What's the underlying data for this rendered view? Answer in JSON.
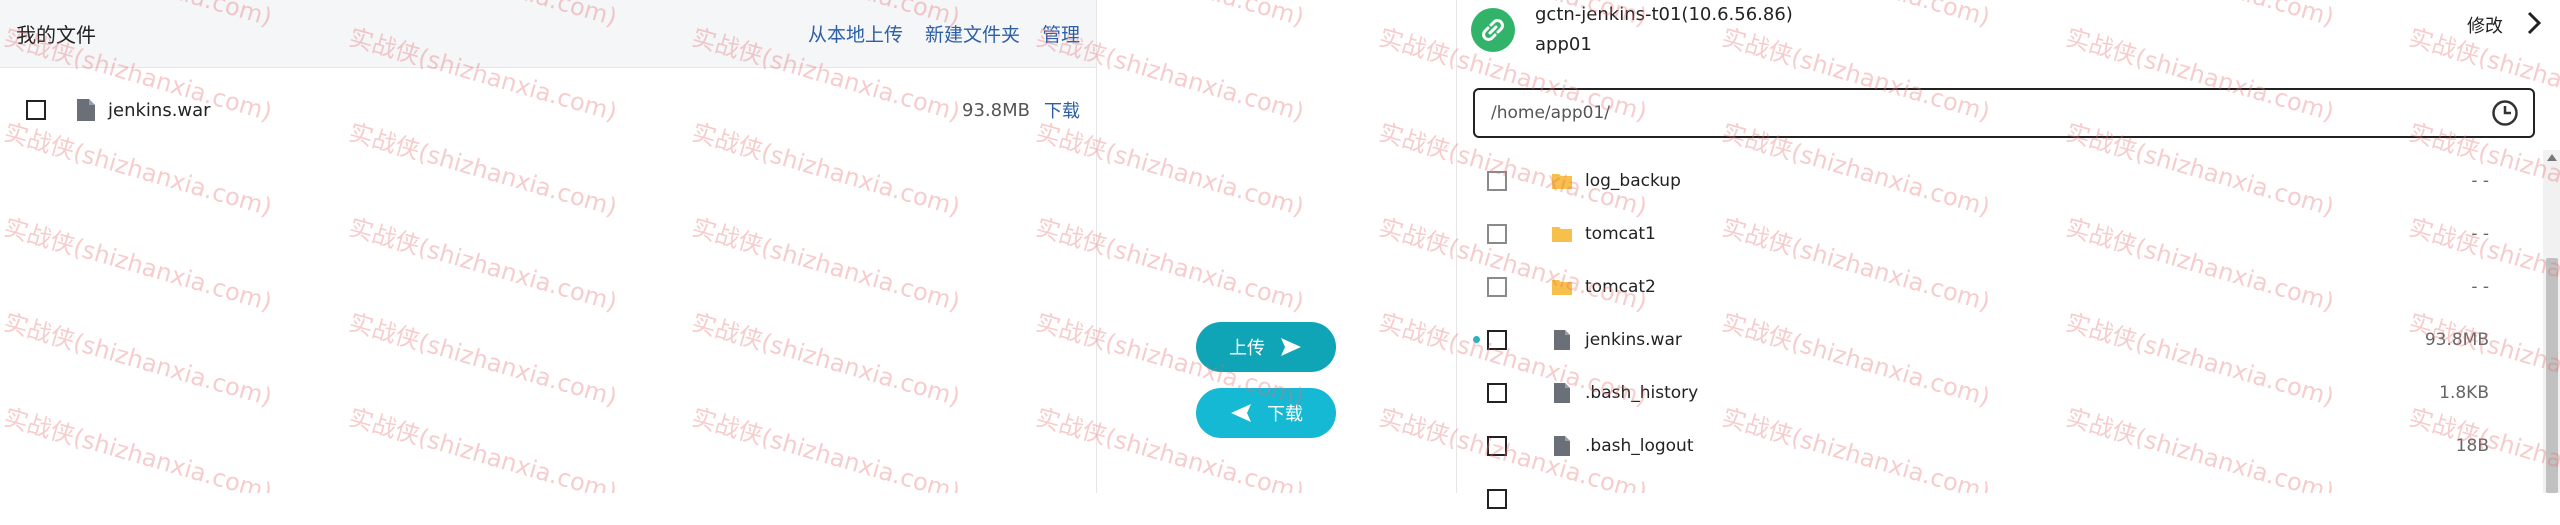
{
  "left": {
    "title": "我的文件",
    "actions": [
      "从本地上传",
      "新建文件夹",
      "管理"
    ],
    "file": {
      "name": "jenkins.war",
      "size": "93.8MB",
      "action": "下载"
    }
  },
  "transfer": {
    "upload_label": "上传",
    "download_label": "下载"
  },
  "right": {
    "server_name": "gctn-jenkins-t01(10.6.56.86)",
    "user": "app01",
    "edit_label": "修改",
    "path": "/home/app01/",
    "files": [
      {
        "name": "log_backup",
        "type": "folder",
        "size": "- -"
      },
      {
        "name": "tomcat1",
        "type": "folder",
        "size": "- -"
      },
      {
        "name": "tomcat2",
        "type": "folder",
        "size": "- -"
      },
      {
        "name": "jenkins.war",
        "type": "file",
        "size": "93.8MB",
        "highlight": true
      },
      {
        "name": ".bash_history",
        "type": "file",
        "size": "1.8KB"
      },
      {
        "name": ".bash_logout",
        "type": "file",
        "size": "18B"
      }
    ]
  },
  "watermark": "实战侠(shizhanxia.com)",
  "colors": {
    "link": "#2d5fa6",
    "upload": "#0fa4b6",
    "download": "#16b9d4",
    "server_icon": "#31b46a",
    "folder": "#f7c04a",
    "file_icon": "#6b7078"
  }
}
